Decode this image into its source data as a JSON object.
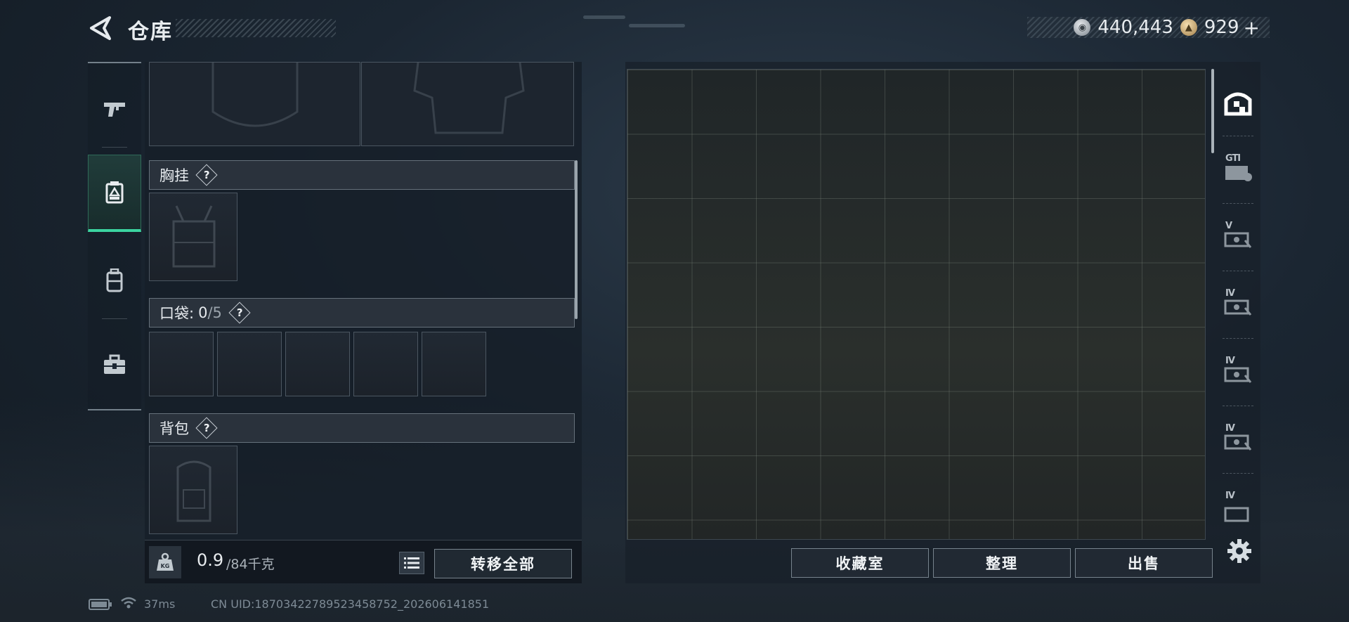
{
  "header": {
    "title": "仓库",
    "currency": [
      {
        "icon": "silver-coin-icon",
        "value": "440,443"
      },
      {
        "icon": "gold-coin-icon",
        "value": "929",
        "suffix": "+"
      }
    ]
  },
  "rail": {
    "items": [
      {
        "name": "weapons",
        "icon": "pistol-icon",
        "active": false
      },
      {
        "name": "gear",
        "icon": "equipment-icon",
        "active": true
      },
      {
        "name": "backpack",
        "icon": "backpack-icon",
        "active": false
      },
      {
        "name": "kit",
        "icon": "toolbox-icon",
        "active": false
      }
    ]
  },
  "equipment": {
    "chest_rig_label": "胸挂",
    "pockets_label": "口袋:",
    "pockets_count": "0",
    "pockets_max": "/5",
    "backpack_label": "背包",
    "help_glyph": "?",
    "weight_current": "0.9",
    "weight_max": "/84千克",
    "kg_label": "KG",
    "transfer_all": "转移全部"
  },
  "stash": {
    "tabs": [
      {
        "icon": "main-stash-icon",
        "label": ""
      },
      {
        "icon": "gti-case-icon",
        "label": "GTI"
      },
      {
        "icon": "case-v-icon",
        "label": "V"
      },
      {
        "icon": "case-iv-icon",
        "label": "IV"
      },
      {
        "icon": "case-iv-icon",
        "label": "IV"
      },
      {
        "icon": "case-iv-icon",
        "label": "IV"
      },
      {
        "icon": "case-iv-icon",
        "label": "IV"
      }
    ],
    "buttons": {
      "collection": "收藏室",
      "sort": "整理",
      "sell": "出售"
    }
  },
  "status": {
    "ping": "37ms",
    "uid": "CN UID:18703422789523458752_202606141851"
  }
}
